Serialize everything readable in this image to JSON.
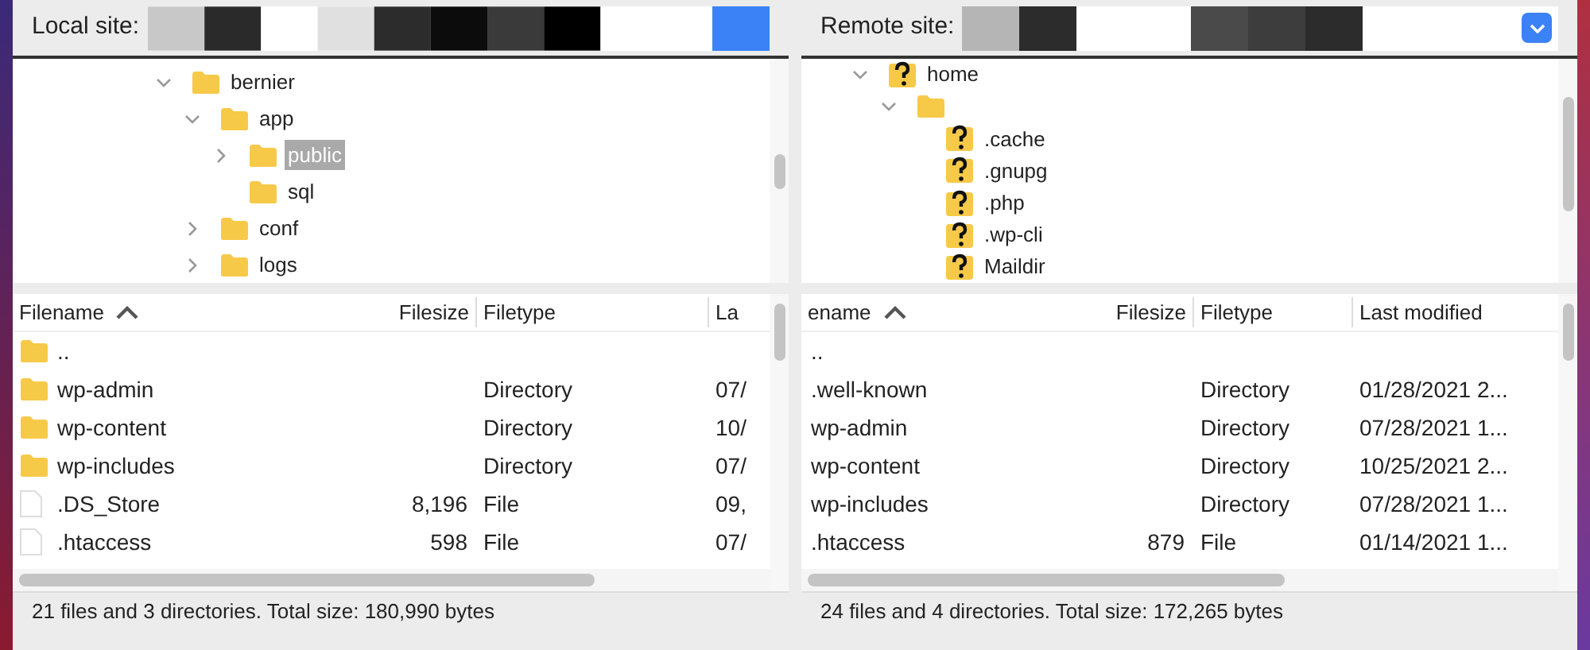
{
  "panes": [
    {
      "site_label": "Local site:",
      "dropdown": false,
      "tree": [
        {
          "name": "bernier",
          "kind": "folder",
          "expanded": true,
          "selected": false,
          "children": [
            {
              "name": "app",
              "kind": "folder",
              "expanded": true,
              "selected": false,
              "children": [
                {
                  "name": "public",
                  "kind": "folder",
                  "expanded": false,
                  "selected": true
                },
                {
                  "name": "sql",
                  "kind": "folder",
                  "selected": false
                }
              ]
            },
            {
              "name": "conf",
              "kind": "folder",
              "expanded": false,
              "selected": false
            },
            {
              "name": "logs",
              "kind": "folder",
              "expanded": false,
              "selected": false
            }
          ]
        }
      ],
      "columns": [
        {
          "label": "Filename",
          "sorted": true
        },
        {
          "label": "Filesize"
        },
        {
          "label": "Filetype"
        },
        {
          "label": "La"
        }
      ],
      "rows": [
        {
          "kind": "folder",
          "cells": [
            "..",
            "",
            "",
            ""
          ]
        },
        {
          "kind": "folder",
          "cells": [
            "wp-admin",
            "",
            "Directory",
            "07/"
          ]
        },
        {
          "kind": "folder",
          "cells": [
            "wp-content",
            "",
            "Directory",
            "10/"
          ]
        },
        {
          "kind": "folder",
          "cells": [
            "wp-includes",
            "",
            "Directory",
            "07/"
          ]
        },
        {
          "kind": "file",
          "cells": [
            ".DS_Store",
            "8,196",
            "File",
            "09,"
          ]
        },
        {
          "kind": "file",
          "cells": [
            ".htaccess",
            "598",
            "File",
            "07/"
          ]
        }
      ],
      "status": "21 files and 3 directories. Total size: 180,990 bytes"
    },
    {
      "site_label": "Remote site:",
      "dropdown": true,
      "tree": [
        {
          "name": "home",
          "kind": "unknown",
          "expanded": true,
          "selected": false,
          "children": [
            {
              "kind": "folder",
              "expanded": true,
              "children": [
                {
                  "name": ".cache",
                  "kind": "unknown",
                  "selected": false
                },
                {
                  "name": ".gnupg",
                  "kind": "unknown",
                  "selected": false
                },
                {
                  "name": ".php",
                  "kind": "unknown",
                  "selected": false
                },
                {
                  "name": ".wp-cli",
                  "kind": "unknown",
                  "selected": false
                },
                {
                  "name": "Maildir",
                  "kind": "unknown",
                  "selected": false
                }
              ]
            }
          ]
        }
      ],
      "columns": [
        {
          "label": "ename",
          "sorted": true
        },
        {
          "label": "Filesize"
        },
        {
          "label": "Filetype"
        },
        {
          "label": "Last modified"
        }
      ],
      "rows": [
        {
          "kind": "none",
          "cells": [
            "..",
            "",
            "",
            ""
          ]
        },
        {
          "kind": "none",
          "cells": [
            ".well-known",
            "",
            "Directory",
            "01/28/2021 2..."
          ]
        },
        {
          "kind": "none",
          "cells": [
            "wp-admin",
            "",
            "Directory",
            "07/28/2021 1..."
          ]
        },
        {
          "kind": "none",
          "cells": [
            "wp-content",
            "",
            "Directory",
            "10/25/2021 2..."
          ]
        },
        {
          "kind": "none",
          "cells": [
            "wp-includes",
            "",
            "Directory",
            "07/28/2021 1..."
          ]
        },
        {
          "kind": "none",
          "cells": [
            ".htaccess",
            "879",
            "File",
            "01/14/2021 1..."
          ]
        }
      ],
      "status": "24 files and 4 directories. Total size: 172,265 bytes"
    }
  ]
}
